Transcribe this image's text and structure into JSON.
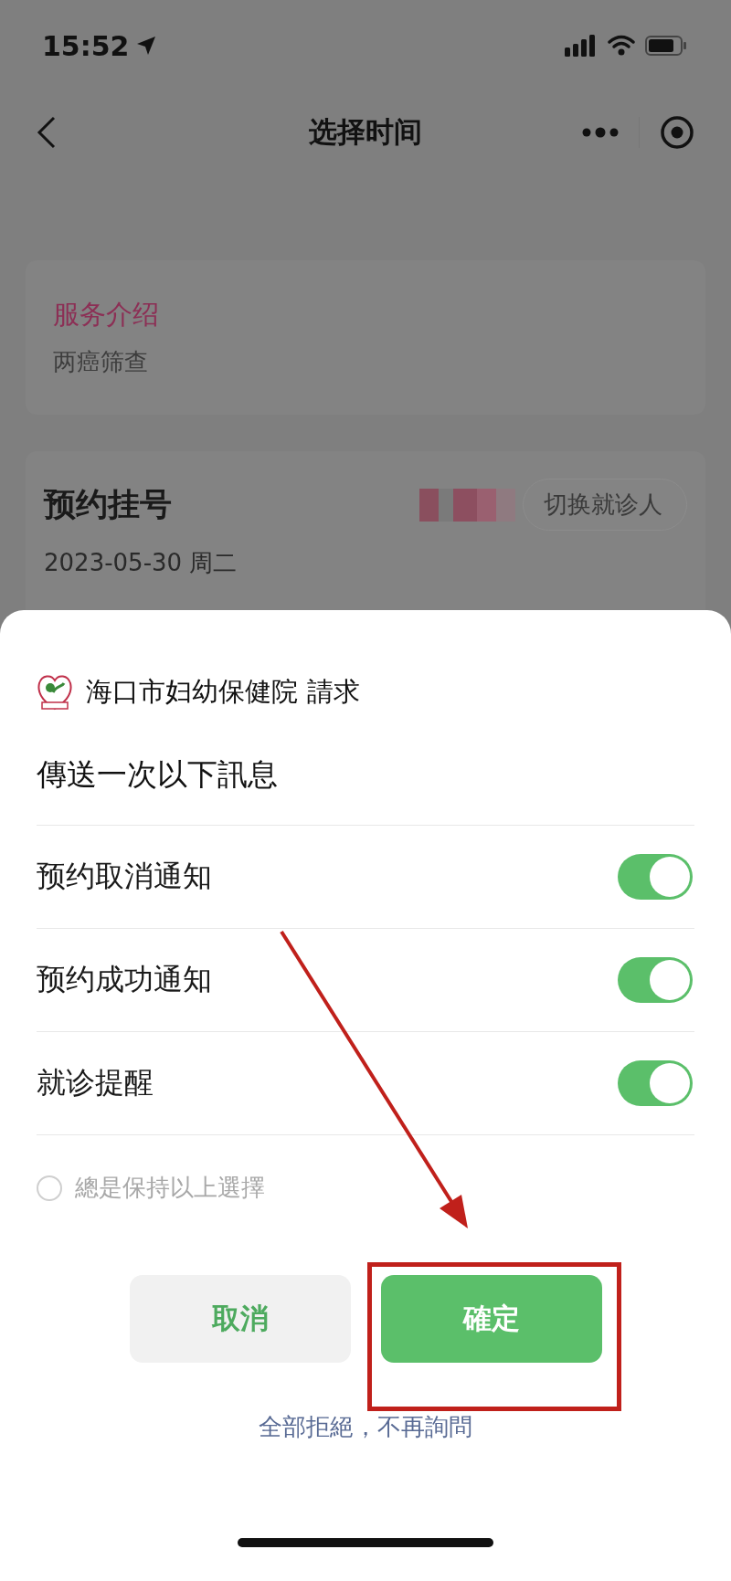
{
  "status_bar": {
    "time": "15:52"
  },
  "nav_bar": {
    "title": "选择时间"
  },
  "service_card": {
    "heading": "服务介绍",
    "text": "两癌筛查"
  },
  "booking_card": {
    "heading": "预约挂号",
    "switch_patient": "切换就诊人",
    "date": "2023-05-30 周二"
  },
  "dialog": {
    "requester": "海口市妇幼保健院",
    "request_word": "請求",
    "subtitle": "傳送一次以下訊息",
    "options": [
      {
        "label": "预约取消通知",
        "on": true
      },
      {
        "label": "预约成功通知",
        "on": true
      },
      {
        "label": "就诊提醒",
        "on": true
      }
    ],
    "remember": {
      "label": "總是保持以上選擇",
      "checked": false
    },
    "buttons": [
      {
        "label": "取消",
        "kind": "secondary"
      },
      {
        "label": "確定",
        "kind": "primary"
      }
    ],
    "reject_link": "全部拒絕，不再詢問"
  }
}
